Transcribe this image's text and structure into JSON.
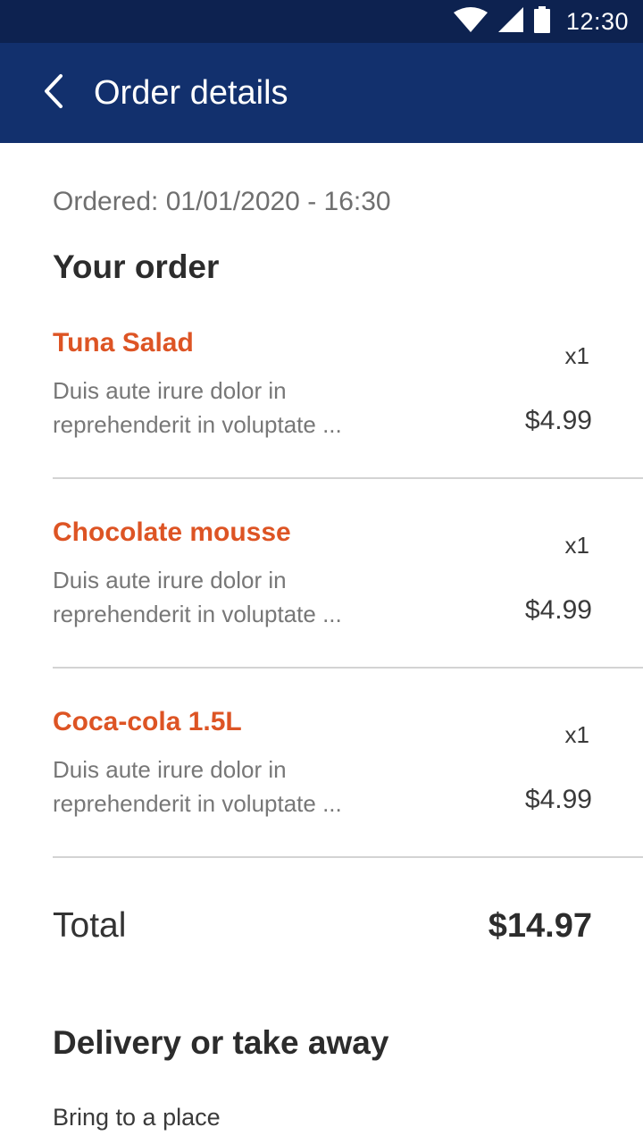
{
  "status_bar": {
    "time": "12:30",
    "icons": [
      "wifi-icon",
      "cell-signal-icon",
      "battery-icon"
    ]
  },
  "app_bar": {
    "title": "Order details",
    "back_icon": "chevron-left-icon"
  },
  "order": {
    "ordered_label": "Ordered: 01/01/2020 - 16:30",
    "section_title": "Your order",
    "items": [
      {
        "name": "Tuna Salad",
        "quantity": "x1",
        "description_line1": "Duis aute irure dolor in",
        "description_line2": "reprehenderit in voluptate ...",
        "price": "$4.99"
      },
      {
        "name": "Chocolate mousse",
        "quantity": "x1",
        "description_line1": "Duis aute irure dolor in",
        "description_line2": "reprehenderit in voluptate ...",
        "price": "$4.99"
      },
      {
        "name": "Coca-cola 1.5L",
        "quantity": "x1",
        "description_line1": "Duis aute irure dolor in",
        "description_line2": "reprehenderit in voluptate ...",
        "price": "$4.99"
      }
    ],
    "total_label": "Total",
    "total_value": "$14.97"
  },
  "delivery": {
    "section_title": "Delivery or take away",
    "option_label": "Bring to a place"
  },
  "colors": {
    "status_bar": "#0d2250",
    "app_bar": "#12306d",
    "item_name": "#dd5424",
    "divider": "#d3d3d3"
  }
}
